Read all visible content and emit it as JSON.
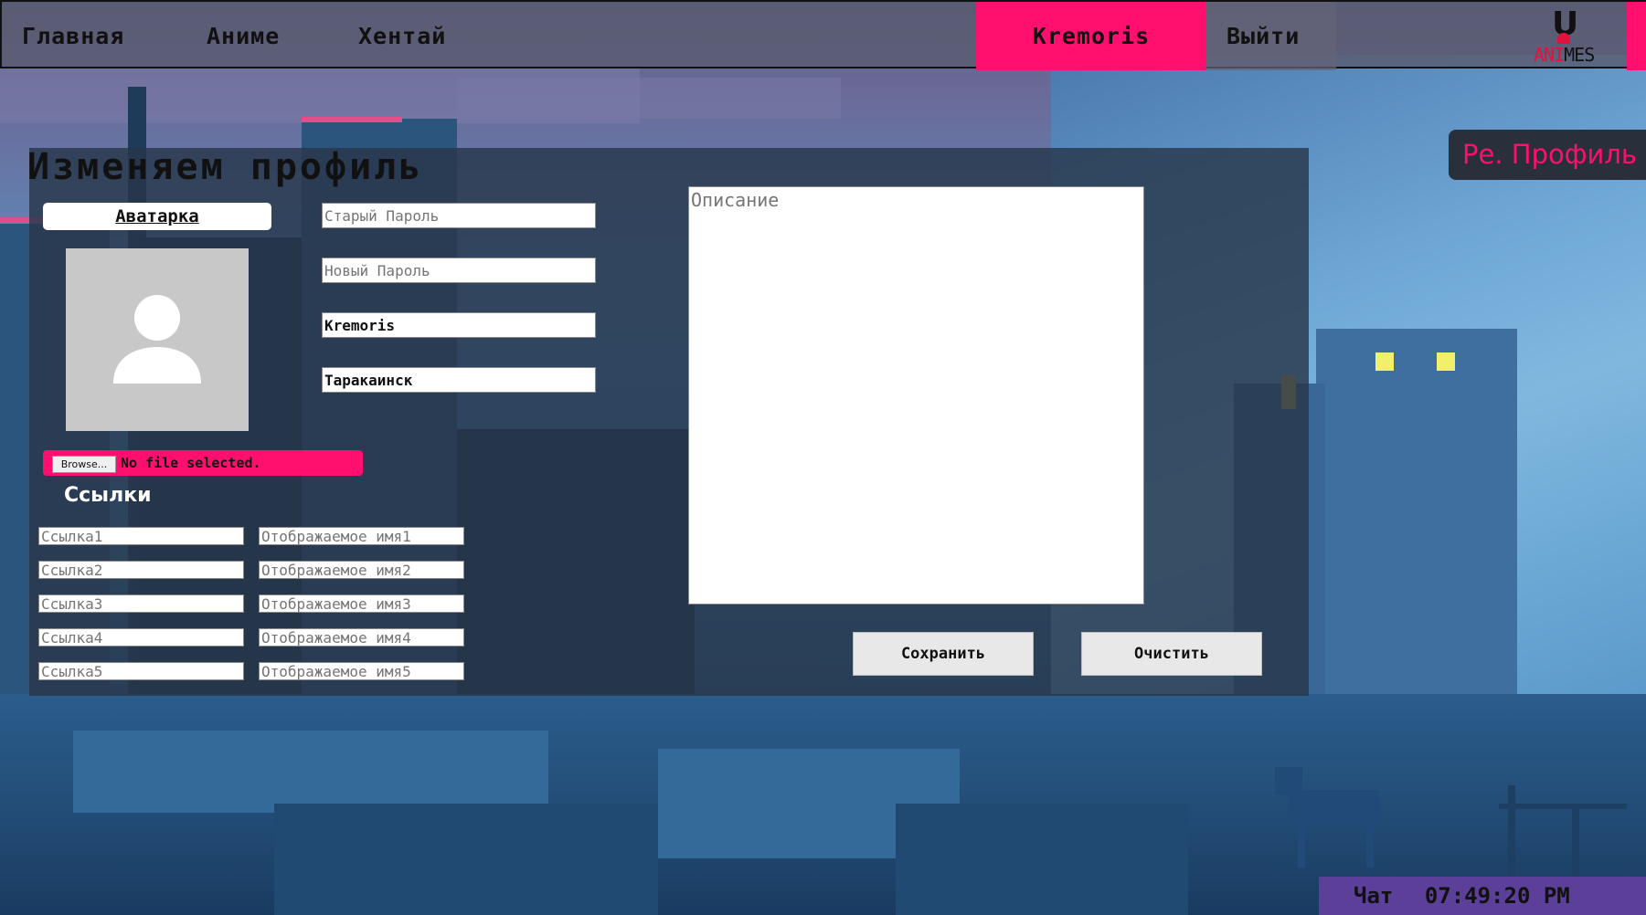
{
  "nav": {
    "items": [
      {
        "label": "Главная"
      },
      {
        "label": "Аниме"
      },
      {
        "label": "Хентай"
      }
    ],
    "user_label": "Kremoris",
    "logout_label": "Выйти"
  },
  "logo": {
    "letter": "U",
    "text_prefix": "ANI",
    "text_suffix": "MES"
  },
  "side_label": "Ре. Профиль",
  "page_title": "Изменяем профиль",
  "avatar": {
    "label": "Аватарка"
  },
  "file_upload": {
    "button_label": "Browse...",
    "status": "No file selected."
  },
  "links": {
    "heading": "Ссылки",
    "rows": [
      {
        "url_placeholder": "Ссылка1",
        "name_placeholder": "Отображаемое имя1"
      },
      {
        "url_placeholder": "Ссылка2",
        "name_placeholder": "Отображаемое имя2"
      },
      {
        "url_placeholder": "Ссылка3",
        "name_placeholder": "Отображаемое имя3"
      },
      {
        "url_placeholder": "Ссылка4",
        "name_placeholder": "Отображаемое имя4"
      },
      {
        "url_placeholder": "Ссылка5",
        "name_placeholder": "Отображаемое имя5"
      }
    ]
  },
  "fields": {
    "old_password": {
      "placeholder": "Старый Пароль",
      "value": ""
    },
    "new_password": {
      "placeholder": "Новый Пароль",
      "value": ""
    },
    "nickname": {
      "value": "Kremoris"
    },
    "city": {
      "value": "Таракаинск"
    }
  },
  "description": {
    "placeholder": "Описание",
    "value": ""
  },
  "buttons": {
    "save": "Сохранить",
    "clear": "Очистить"
  },
  "clock": {
    "label": "Чат",
    "time": "07:49:20 PM"
  },
  "colors": {
    "accent_pink": "#ff0f6e",
    "nav_bg": "#5a5c70",
    "panel_bg": "#28374b",
    "clock_bg": "#5b3f99"
  }
}
